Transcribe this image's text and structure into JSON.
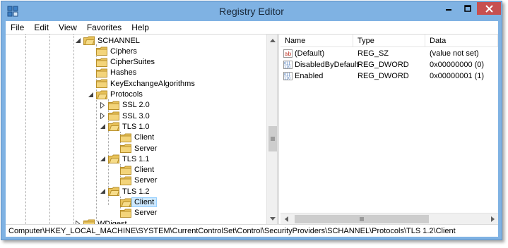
{
  "window": {
    "title": "Registry Editor"
  },
  "menu": [
    "File",
    "Edit",
    "View",
    "Favorites",
    "Help"
  ],
  "tree": [
    {
      "label": "SCHANNEL",
      "state": "expanded"
    },
    {
      "label": "Ciphers",
      "state": "leaf"
    },
    {
      "label": "CipherSuites",
      "state": "leaf"
    },
    {
      "label": "Hashes",
      "state": "leaf"
    },
    {
      "label": "KeyExchangeAlgorithms",
      "state": "leaf"
    },
    {
      "label": "Protocols",
      "state": "expanded"
    },
    {
      "label": "SSL 2.0",
      "state": "collapsed"
    },
    {
      "label": "SSL 3.0",
      "state": "collapsed"
    },
    {
      "label": "TLS 1.0",
      "state": "expanded"
    },
    {
      "label": "Client",
      "state": "leaf"
    },
    {
      "label": "Server",
      "state": "leaf"
    },
    {
      "label": "TLS 1.1",
      "state": "expanded"
    },
    {
      "label": "Client",
      "state": "leaf"
    },
    {
      "label": "Server",
      "state": "leaf"
    },
    {
      "label": "TLS 1.2",
      "state": "expanded"
    },
    {
      "label": "Client",
      "state": "leaf",
      "selected": true
    },
    {
      "label": "Server",
      "state": "leaf"
    },
    {
      "label": "WDigest",
      "state": "collapsed"
    }
  ],
  "values_header": {
    "name": "Name",
    "type": "Type",
    "data": "Data"
  },
  "values": [
    {
      "name": "(Default)",
      "type": "REG_SZ",
      "data": "(value not set)",
      "icon": "string-value-icon"
    },
    {
      "name": "DisabledByDefault",
      "type": "REG_DWORD",
      "data": "0x00000000 (0)",
      "icon": "binary-value-icon"
    },
    {
      "name": "Enabled",
      "type": "REG_DWORD",
      "data": "0x00000001 (1)",
      "icon": "binary-value-icon"
    }
  ],
  "status": {
    "path": "Computer\\HKEY_LOCAL_MACHINE\\SYSTEM\\CurrentControlSet\\Control\\SecurityProviders\\SCHANNEL\\Protocols\\TLS 1.2\\Client"
  },
  "colors": {
    "title_bar": "#7fb2e3",
    "close_button": "#c75050",
    "folder": "#e8c25a",
    "selection": "#cce8ff"
  }
}
